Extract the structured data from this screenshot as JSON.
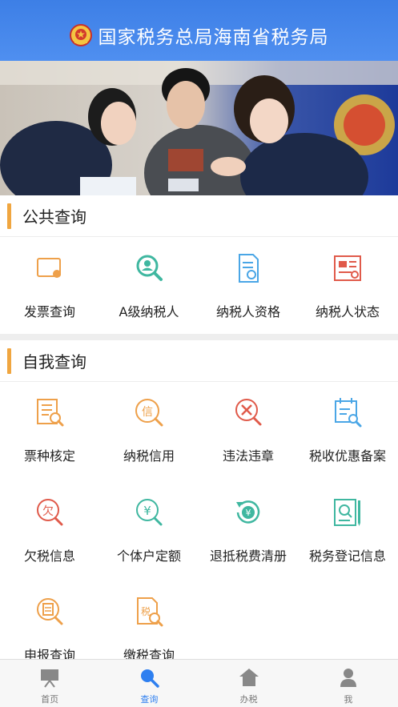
{
  "header": {
    "title": "国家税务总局海南省税务局",
    "emblem_icon": "tax-emblem-icon",
    "background": "#4a8aee"
  },
  "banner": {
    "image": "tax-officers-helping-taxpayer-photo"
  },
  "public_query": {
    "title": "公共查询",
    "items": [
      {
        "label": "发票查询",
        "icon": "invoice-query-icon"
      },
      {
        "label": "A级纳税人",
        "icon": "a-level-taxpayer-icon"
      },
      {
        "label": "纳税人资格",
        "icon": "taxpayer-qualification-icon"
      },
      {
        "label": "纳税人状态",
        "icon": "taxpayer-status-icon"
      }
    ]
  },
  "self_query": {
    "title": "自我查询",
    "items": [
      {
        "label": "票种核定",
        "icon": "ticket-type-approval-icon"
      },
      {
        "label": "纳税信用",
        "icon": "tax-credit-icon"
      },
      {
        "label": "违法违章",
        "icon": "violation-icon"
      },
      {
        "label": "税收优惠备案",
        "icon": "tax-preference-filing-icon"
      },
      {
        "label": "欠税信息",
        "icon": "tax-arrears-icon"
      },
      {
        "label": "个体户定额",
        "icon": "individual-quota-icon"
      },
      {
        "label": "退抵税费清册",
        "icon": "tax-refund-list-icon"
      },
      {
        "label": "税务登记信息",
        "icon": "tax-registration-icon"
      },
      {
        "label": "申报查询",
        "icon": "declaration-query-icon"
      },
      {
        "label": "缴税查询",
        "icon": "tax-payment-query-icon"
      }
    ]
  },
  "tabbar": {
    "active": "查询",
    "tabs": [
      {
        "label": "首页",
        "icon": "home-board-icon"
      },
      {
        "label": "查询",
        "icon": "search-icon"
      },
      {
        "label": "办税",
        "icon": "house-icon"
      },
      {
        "label": "我",
        "icon": "person-icon"
      }
    ]
  },
  "colors": {
    "accent_bar": "#f0a640",
    "active_tab": "#2e7ff0",
    "orange": "#eea04a",
    "teal": "#3fb7a0",
    "blue": "#4aa6e6",
    "red": "#e05a4a"
  }
}
